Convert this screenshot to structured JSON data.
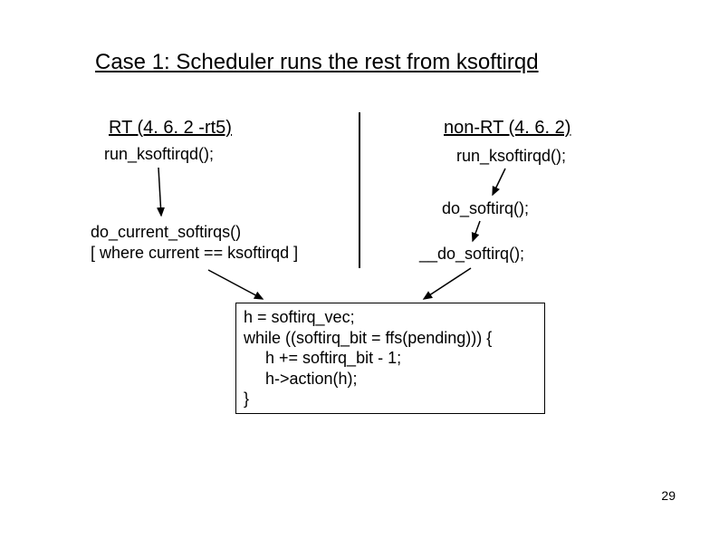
{
  "title": "Case 1: Scheduler runs the rest from ksoftirqd",
  "left": {
    "heading": "RT (4. 6. 2 -rt5)",
    "call1": "run_ksoftirqd();",
    "call2_line1": "do_current_softirqs()",
    "call2_line2": "[ where current == ksoftirqd ]"
  },
  "right": {
    "heading": "non-RT (4. 6. 2)",
    "call1": "run_ksoftirqd();",
    "call2": "do_softirq();",
    "call3": "__do_softirq();"
  },
  "code": {
    "l1": "h = softirq_vec;",
    "l2": "while ((softirq_bit = ffs(pending))) {",
    "l3": "h += softirq_bit - 1;",
    "l4": "h->action(h);",
    "l5": "}"
  },
  "page": "29"
}
